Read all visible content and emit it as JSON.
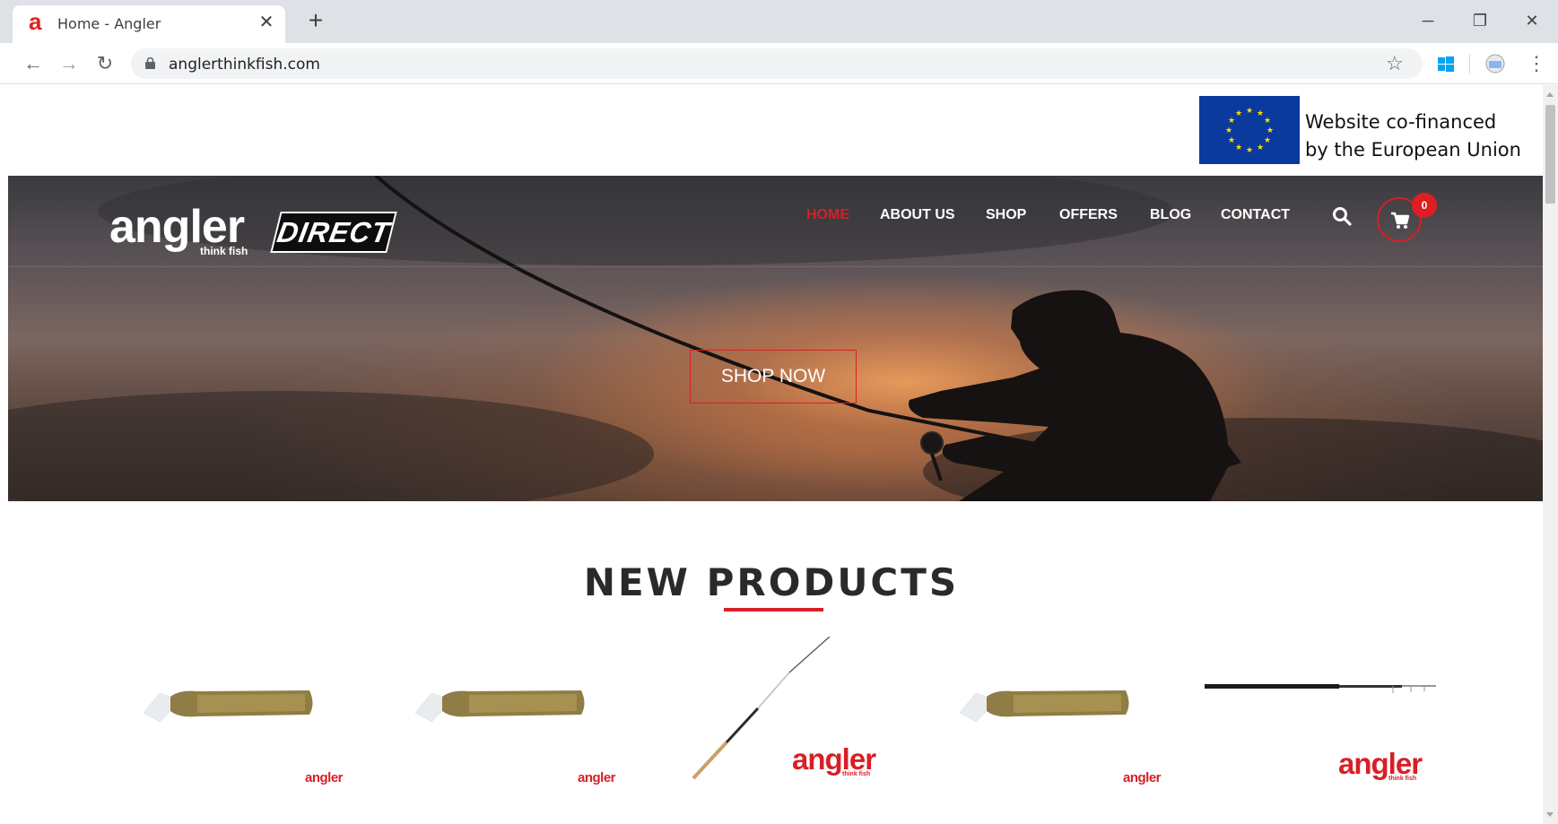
{
  "browser": {
    "tab_title": "Home - Angler",
    "favicon_letter": "a",
    "tab_close": "✕",
    "new_tab": "+",
    "url": "anglerthinkfish.com",
    "window_controls": {
      "minimize": "─",
      "restore": "❐",
      "close": "✕"
    }
  },
  "eu_banner": {
    "line1": "Website co-financed",
    "line2": "by the European Union"
  },
  "header": {
    "logo_main": "angler",
    "logo_tagline": "think fish",
    "logo_badge": "DIRECT",
    "nav": [
      {
        "label": "HOME",
        "active": true
      },
      {
        "label": "ABOUT US",
        "active": false
      },
      {
        "label": "SHOP",
        "active": false
      },
      {
        "label": "OFFERS",
        "active": false
      },
      {
        "label": "BLOG",
        "active": false
      },
      {
        "label": "CONTACT",
        "active": false
      }
    ],
    "cart_count": "0"
  },
  "hero": {
    "cta": "SHOP NOW"
  },
  "new_products": {
    "title": "NEW PRODUCTS",
    "items": [
      {
        "kind": "soft-lure",
        "brand": "angler"
      },
      {
        "kind": "soft-lure",
        "brand": "angler"
      },
      {
        "kind": "rod",
        "brand": "angler",
        "brand_tag": "think fish"
      },
      {
        "kind": "soft-lure",
        "brand": "angler"
      },
      {
        "kind": "telescopic-rod",
        "brand": "angler",
        "brand_tag": "think fish"
      }
    ]
  },
  "colors": {
    "accent": "#d81f26",
    "eu_blue": "#0b3a9e",
    "eu_star": "#ffdd00"
  },
  "icons": [
    "back-icon",
    "forward-icon",
    "reload-icon",
    "lock-icon",
    "star-icon",
    "windows-icon",
    "profile-icon",
    "menu-icon",
    "search-icon",
    "cart-icon"
  ]
}
